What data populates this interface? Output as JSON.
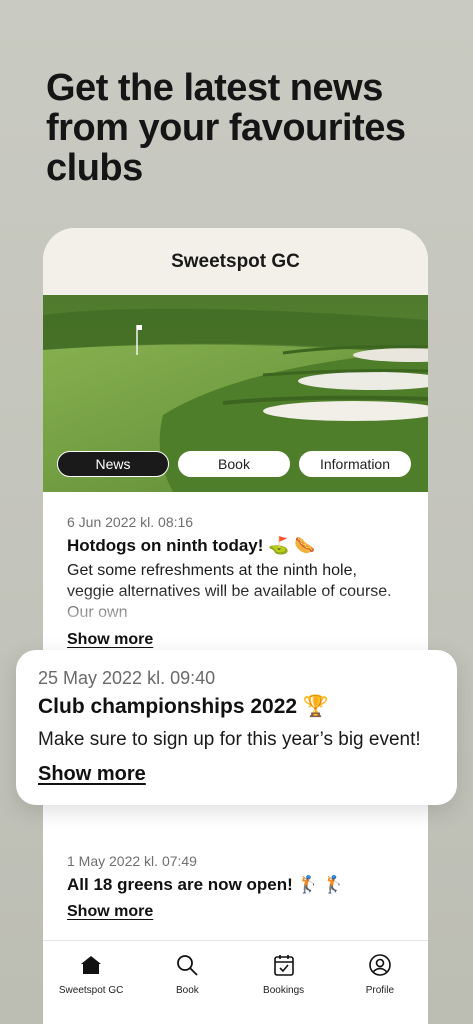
{
  "headline": "Get the latest news from your favourites clubs",
  "club": {
    "name": "Sweetspot GC"
  },
  "hero_tabs": [
    {
      "label": "News",
      "active": true
    },
    {
      "label": "Book",
      "active": false
    },
    {
      "label": "Information",
      "active": false
    }
  ],
  "news": [
    {
      "date": "6 Jun 2022 kl. 08:16",
      "title": "Hotdogs on ninth today! ⛳ 🌭",
      "body": "Get some refreshments at the ninth hole, veggie alternatives will be available of course. Our own",
      "show_more": "Show more"
    },
    {
      "date": "1 May 2022 kl. 07:49",
      "title": "All 18 greens are now open! 🏌️ 🏌️",
      "show_more": "Show more"
    }
  ],
  "featured": {
    "date": "25 May 2022 kl. 09:40",
    "title": "Club championships 2022 🏆",
    "body": "Make sure to sign up for this year’s big event!",
    "show_more": "Show more"
  },
  "tabbar": [
    {
      "label": "Sweetspot GC",
      "icon": "home-icon"
    },
    {
      "label": "Book",
      "icon": "search-icon"
    },
    {
      "label": "Bookings",
      "icon": "calendar-check-icon"
    },
    {
      "label": "Profile",
      "icon": "profile-icon"
    }
  ],
  "colors": {
    "background": "#c3c4bb",
    "header": "#f2f0e9",
    "active_tab": "#1a1a1a"
  }
}
